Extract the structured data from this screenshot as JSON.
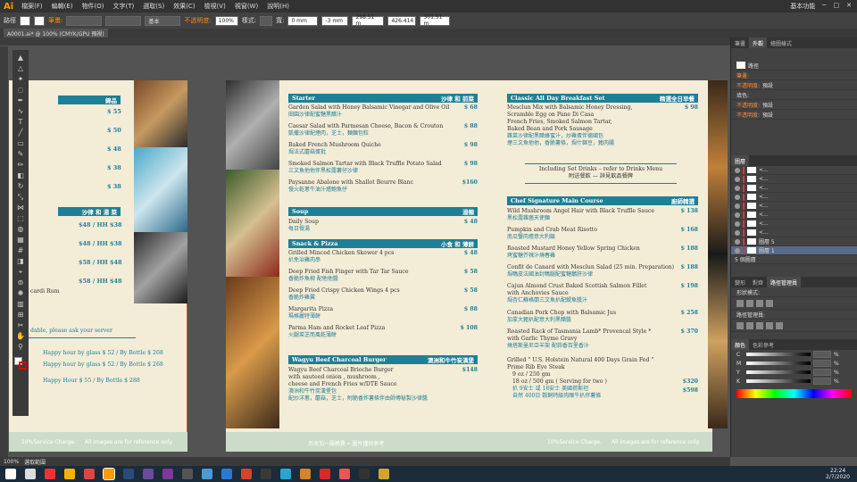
{
  "app": {
    "logo": "Ai",
    "menus": [
      "檔案(F)",
      "編輯(E)",
      "物件(O)",
      "文字(T)",
      "選取(S)",
      "效果(C)",
      "檢視(V)",
      "視窗(W)",
      "說明(H)"
    ],
    "workspace": "基本功能"
  },
  "options": {
    "path": "路徑",
    "stroke_label": "筆畫:",
    "stroke_style": "基本",
    "opacity_label": "不透明度:",
    "opacity": "100%",
    "style_label": "樣式:",
    "width_label": "寬:",
    "width": "0 mm",
    "x": "-3 mm",
    "y": "298.51 m",
    "w": "426.414",
    "h": "301.51 m"
  },
  "doc": {
    "tab": "A0001.ai* @ 100% (CMYK/GPU 預視)",
    "zoom": "100%",
    "status": "選取範圍"
  },
  "left_page": {
    "header1": "錦品",
    "prices1": [
      "$ 55",
      "$ 50",
      "$ 48",
      "$ 38",
      "$ 38"
    ],
    "header2": "沙律 和 湯 菜",
    "prices2": [
      "$48 / HH $38",
      "$48 / HH $38",
      "$58 / HH $48",
      "$58 / HH $48"
    ],
    "frag1": "cardi Rum",
    "frag2": "dable, please ask your server",
    "happy": [
      "Happy hour by glass $ 52 / By Bottle $ 268",
      "Happy hour by glass $ 52 / By Bottle $ 268",
      "Happy Hour $ 55 / By Bottle $ 288"
    ],
    "footer": [
      "10%Service Charge.",
      "All images are for reference only."
    ]
  },
  "right_page": {
    "starter": {
      "title": "Starter",
      "cn": "沙律 和 前菜",
      "items": [
        {
          "en": "Garden Salad with Honey Balsamic Vinegar and Olive Oil",
          "cn": "田園沙律配蜜糖黑醋汁",
          "price": "$ 68"
        },
        {
          "en": "Caesar Salad with Parmesan Cheese, Bacon & Crouton",
          "cn": "凱撒沙律配煙肉，芝士，麵麵包粒",
          "price": "$ 88"
        },
        {
          "en": "Baked French Mushroom Quiche",
          "cn": "焗法式蘑菇蛋批",
          "price": "$ 98"
        },
        {
          "en": "Smoked Salmon Tartar with Black Truffle Potato Salad",
          "cn": "三文魚他他伴黑松露薯仔沙律",
          "price": "$ 98"
        },
        {
          "en": "Paysanne Abalone with Shallot Beurre Blanc",
          "cn": "慢火乾蔥牛油汁燴鮑魚仔",
          "price": "$160"
        }
      ]
    },
    "soup": {
      "title": "Soup",
      "cn": "湯類",
      "items": [
        {
          "en": "Daily Soup",
          "cn": "每日餐湯",
          "price": "$ 48"
        }
      ]
    },
    "snack": {
      "title": "Snack & Pizza",
      "cn": "小食 和 薄餅",
      "items": [
        {
          "en": "Grilled Minced Chicken Skewer 4 pcs",
          "cn": "扒免治雞肉串",
          "price": "$ 48"
        },
        {
          "en": "Deep Fried Fish Finger with Tar Tar Sauce",
          "cn": "香脆炸魚柳 配他他醬",
          "price": "$ 58"
        },
        {
          "en": "Deep Fried Crispy Chicken Wings 4 pcs",
          "cn": "香脆炸雞翼",
          "price": "$ 58"
        },
        {
          "en": "Margarita Pizza",
          "cn": "瑪格麗特薄餅",
          "price": "$ 88"
        },
        {
          "en": "Parma Ham and Rocket Leaf Pizza",
          "cn": "火腿菜芝而風乾薄餅",
          "price": "$ 108"
        }
      ]
    },
    "wagyu": {
      "title": "Wagyu Beef Charcoal Burger",
      "cn": "澳洲和牛竹炭漢堡",
      "en": "Wagyu Beef Charcoal Brioche Burger",
      "lines": [
        "with sauteed onion , mushroom ,",
        "cheese and French Fries w/DTE Sauce"
      ],
      "cn1": "澳洲和牛竹炭漢堡包",
      "cn2": "配炒洋蔥，蘑菇，芝士，附脆香炸薯條伴由師傅秘製沙律醬",
      "price": "$148"
    },
    "breakfast": {
      "title": "Classic All Day Breakfast Set",
      "cn": "精選全日早餐",
      "lines": [
        "Mesclun Mix with Balsamic Honey Dressing,",
        "Scramble Egg on Pane Di Casa",
        "French Fries, Smoked Salmon Tartar,",
        "Baked Bean and Pork Sausage"
      ],
      "cn_lines": [
        "雜菜沙律配黑醋蜂蜜汁，炒雞蛋伴德國包",
        "煙三文魚他他，香脆薯條，焗什錦豆，豬肉腸"
      ],
      "price": "$ 98",
      "note": "Including Set Drinks – refer to Drinks Menu",
      "note_cn": "附送餐飲 — 詳見飲品餐牌"
    },
    "signature": {
      "title": "Chef Signature Main Course",
      "cn": "廚師精選",
      "items": [
        {
          "en": "Wild Mushroom Angel Hair with Black Truffle Sauce",
          "cn": "黑松露雜菌天使麵",
          "price": "$ 138"
        },
        {
          "en": "Pumpkin and Crab Meat Risotto",
          "cn": "南瓜蟹肉燴意大利飯",
          "price": "$ 168"
        },
        {
          "en": "Roasted Mustard Honey Yellow Spring Chicken",
          "cn": "烤蜜糖芥辣汁燒春雞",
          "price": "$ 188"
        },
        {
          "en": "Confit de Canard with Mesclun Salad (25 min. Preparation)",
          "cn": "焗鴨皮法國油封鴨腿配蜜糖鵝肝沙律",
          "price": "$ 188"
        },
        {
          "en": "Cajun Almond Crust Baked Scottish Salmon Fillet",
          "en2": "with Anchovies Sauce",
          "cn": "焗杏仁蘇格蘭三文魚扒配鯷魚醬汁",
          "price": "$ 198"
        },
        {
          "en": "Canadian Pork Chop with Balsamic Jus",
          "cn": "加拿大豬扒配意大利黑醋醬",
          "price": "$ 258"
        },
        {
          "en": "Roasted Rack of Tasmania Lamb* Provencal Style *",
          "en2": "with Garlic Thyme Gravy",
          "cn": "燒塔斯曼尼亞羊架 配蒜香百里香汁",
          "price": "$ 370"
        }
      ],
      "steak": {
        "en": "Grilled \" U.S. Holstein Natural 400 Days Grain Fed \"",
        "en2": "Prime Rib Eye Steak",
        "opt1": "9 oz / 250 gm",
        "price1": "$320",
        "opt2": "18 oz / 500 gm ( Serving for two )",
        "cn1": "扒 9安士 或 18安士 美國荷斯坦",
        "cn2": "自然 400日 穀飼特級肉眼牛扒伴薯條",
        "price2": "$598"
      }
    },
    "footer": [
      "10%Service Charge.",
      "All images are for reference only."
    ],
    "footer_cn": "另收加一服務費 • 圖片僅供參考"
  },
  "panels": {
    "tabs": [
      "筆畫",
      "外觀",
      "繪圖樣式"
    ],
    "appearance": [
      "路徑",
      "筆畫:",
      "不透明度:",
      "預設",
      "填色:",
      "不透明度:",
      "預設",
      "不透明度:",
      "預設"
    ],
    "layers_title": "圖層",
    "layers": [
      "<...",
      "<...",
      "<...",
      "<...",
      "<...",
      "<...",
      "<...",
      "<...",
      "圖層 5",
      "圖層 1"
    ],
    "layers_count": "5 個圖層",
    "transform_tabs": [
      "變形",
      "對齊",
      "路徑管理員"
    ],
    "shape_mode": "形狀模式:",
    "pathfinder": "路徑管理員:",
    "color_tabs": [
      "顏色",
      "色彩參考"
    ],
    "cmyk": [
      "C",
      "M",
      "Y",
      "K"
    ],
    "pct": "%"
  },
  "tray": {
    "time": "22:24",
    "date": "2/7/2020"
  }
}
